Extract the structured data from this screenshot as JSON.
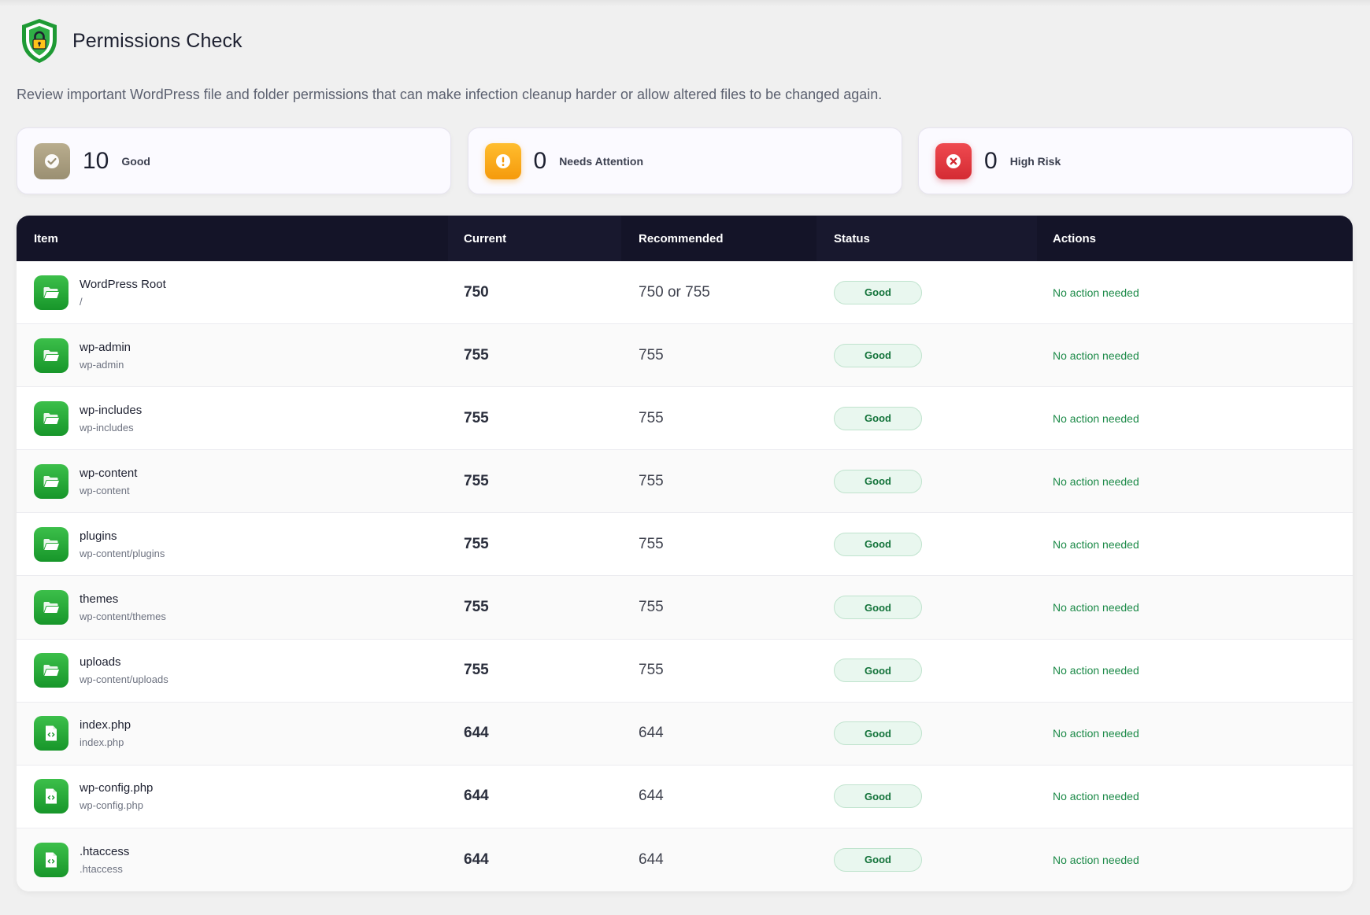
{
  "header": {
    "title": "Permissions Check",
    "subtitle": "Review important WordPress file and folder permissions that can make infection cleanup harder or allow altered files to be changed again.",
    "logo_icon": "shield-lock-icon"
  },
  "summary": {
    "good": {
      "count": "10",
      "label": "Good",
      "icon": "check-circle-icon"
    },
    "attention": {
      "count": "0",
      "label": "Needs Attention",
      "icon": "exclamation-circle-icon"
    },
    "risk": {
      "count": "0",
      "label": "High Risk",
      "icon": "x-circle-icon"
    }
  },
  "table": {
    "columns": {
      "item": "Item",
      "current": "Current",
      "recommended": "Recommended",
      "status": "Status",
      "actions": "Actions"
    },
    "rows": [
      {
        "name": "WordPress Root",
        "path": "/",
        "current": "750",
        "recommended": "750 or 755",
        "status": "Good",
        "action": "No action needed",
        "icon": "folder-open-icon"
      },
      {
        "name": "wp-admin",
        "path": "wp-admin",
        "current": "755",
        "recommended": "755",
        "status": "Good",
        "action": "No action needed",
        "icon": "folder-open-icon"
      },
      {
        "name": "wp-includes",
        "path": "wp-includes",
        "current": "755",
        "recommended": "755",
        "status": "Good",
        "action": "No action needed",
        "icon": "folder-open-icon"
      },
      {
        "name": "wp-content",
        "path": "wp-content",
        "current": "755",
        "recommended": "755",
        "status": "Good",
        "action": "No action needed",
        "icon": "folder-open-icon"
      },
      {
        "name": "plugins",
        "path": "wp-content/plugins",
        "current": "755",
        "recommended": "755",
        "status": "Good",
        "action": "No action needed",
        "icon": "folder-open-icon"
      },
      {
        "name": "themes",
        "path": "wp-content/themes",
        "current": "755",
        "recommended": "755",
        "status": "Good",
        "action": "No action needed",
        "icon": "folder-open-icon"
      },
      {
        "name": "uploads",
        "path": "wp-content/uploads",
        "current": "755",
        "recommended": "755",
        "status": "Good",
        "action": "No action needed",
        "icon": "folder-open-icon"
      },
      {
        "name": "index.php",
        "path": "index.php",
        "current": "644",
        "recommended": "644",
        "status": "Good",
        "action": "No action needed",
        "icon": "file-code-icon"
      },
      {
        "name": "wp-config.php",
        "path": "wp-config.php",
        "current": "644",
        "recommended": "644",
        "status": "Good",
        "action": "No action needed",
        "icon": "file-code-icon"
      },
      {
        "name": ".htaccess",
        "path": ".htaccess",
        "current": "644",
        "recommended": "644",
        "status": "Good",
        "action": "No action needed",
        "icon": "file-code-icon"
      }
    ]
  },
  "colors": {
    "header_bg": "#141428",
    "good_green": "#1c8a48",
    "icon_green": "#17962a",
    "warn_orange": "#f59a0c",
    "risk_red": "#d42b33"
  }
}
